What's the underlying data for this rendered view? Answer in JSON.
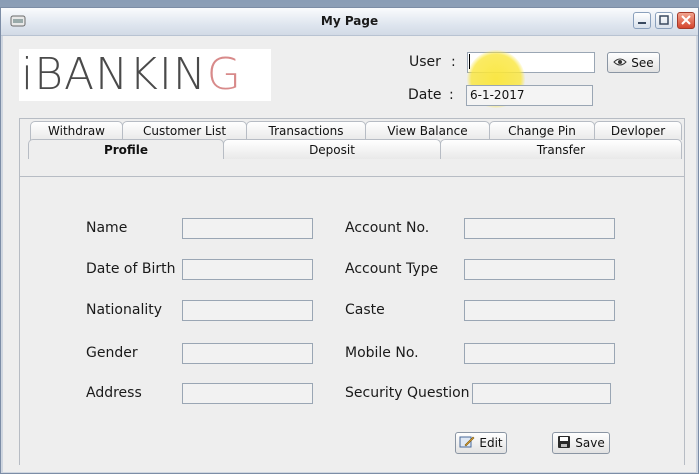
{
  "window": {
    "title": "My Page"
  },
  "logo": {
    "text_main": "iBANKIN",
    "text_accent": "G"
  },
  "header": {
    "user_label": "User",
    "colon": ":",
    "user_value": "",
    "see_label": "See",
    "date_label": "Date",
    "date_value": "6-1-2017"
  },
  "tabs": {
    "row1": [
      "Withdraw",
      "Customer List",
      "Transactions",
      "View Balance",
      "Change Pin",
      "Devloper"
    ],
    "row2": [
      "Profile",
      "Deposit",
      "Transfer"
    ],
    "selected": "Profile"
  },
  "profile_form": {
    "left_labels": [
      "Name",
      "Date of Birth",
      "Nationality",
      "Gender",
      "Address"
    ],
    "right_labels": [
      "Account No.",
      "Account Type",
      "Caste",
      "Mobile No.",
      "Security Question"
    ]
  },
  "buttons": {
    "edit": "Edit",
    "save": "Save"
  },
  "icons": {
    "app": "app-window-icon",
    "see": "eye-icon",
    "edit": "edit-icon",
    "save": "save-icon"
  },
  "colors": {
    "logo_accent": "#d88a8a",
    "highlight": "#f7e33c"
  }
}
